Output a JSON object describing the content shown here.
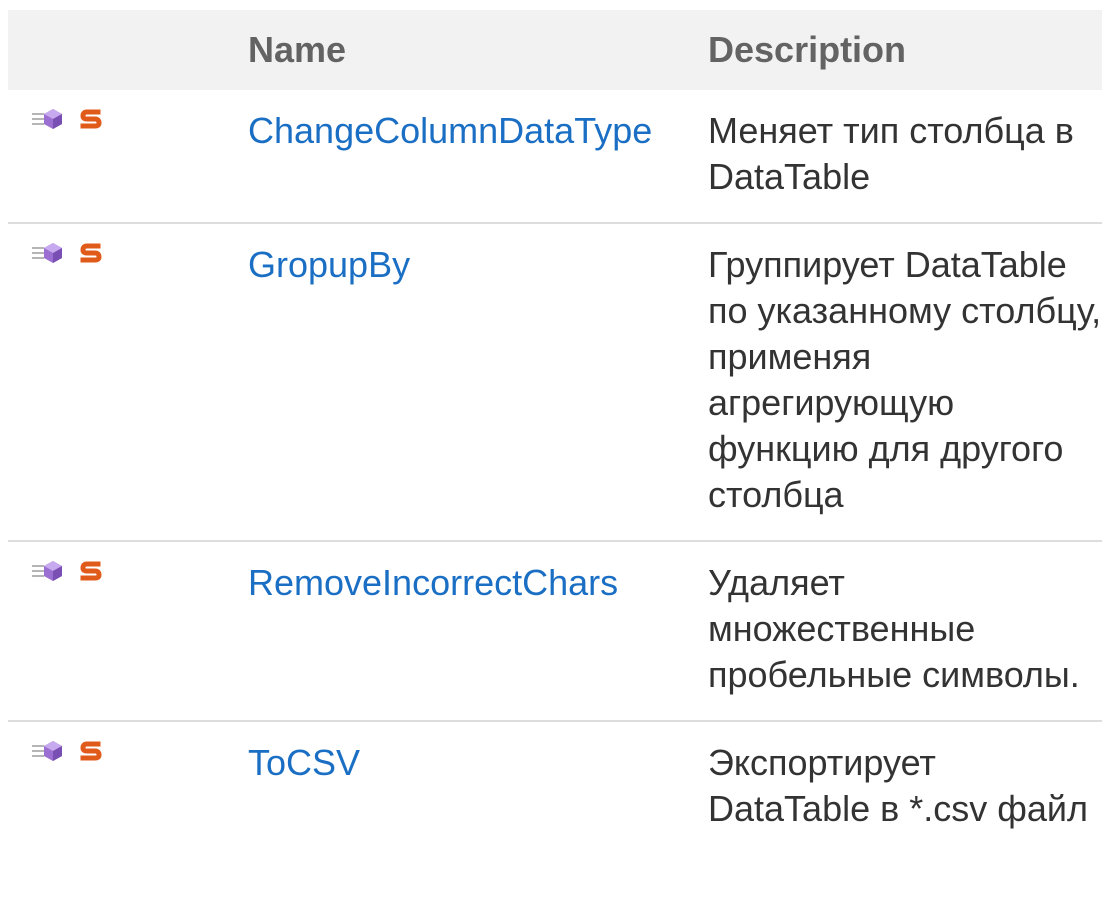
{
  "table": {
    "headers": {
      "icons": "",
      "name": "Name",
      "description": "Description"
    },
    "rows": [
      {
        "icons": [
          "public-method-icon",
          "static-member-icon"
        ],
        "name": "ChangeColumnDataType",
        "description": "Меняет тип столбца в DataTable"
      },
      {
        "icons": [
          "public-method-icon",
          "static-member-icon"
        ],
        "name": "GropupBy",
        "description": "Группирует DataTable по указанному столбцу, применяя агрегирующую функцию для другого столбца"
      },
      {
        "icons": [
          "public-method-icon",
          "static-member-icon"
        ],
        "name": "RemoveIncorrectChars",
        "description": "Удаляет множественные пробельные символы."
      },
      {
        "icons": [
          "public-method-icon",
          "static-member-icon"
        ],
        "name": "ToCSV",
        "description": "Экспортирует DataTable в *.csv файл"
      }
    ]
  },
  "colors": {
    "header_bg": "#f2f2f2",
    "header_text": "#636363",
    "link": "#1a6fc4",
    "body_text": "#333333",
    "row_divider": "#dddddd",
    "static_icon": "#e05a1a",
    "method_icon": "#9b6fd1"
  }
}
